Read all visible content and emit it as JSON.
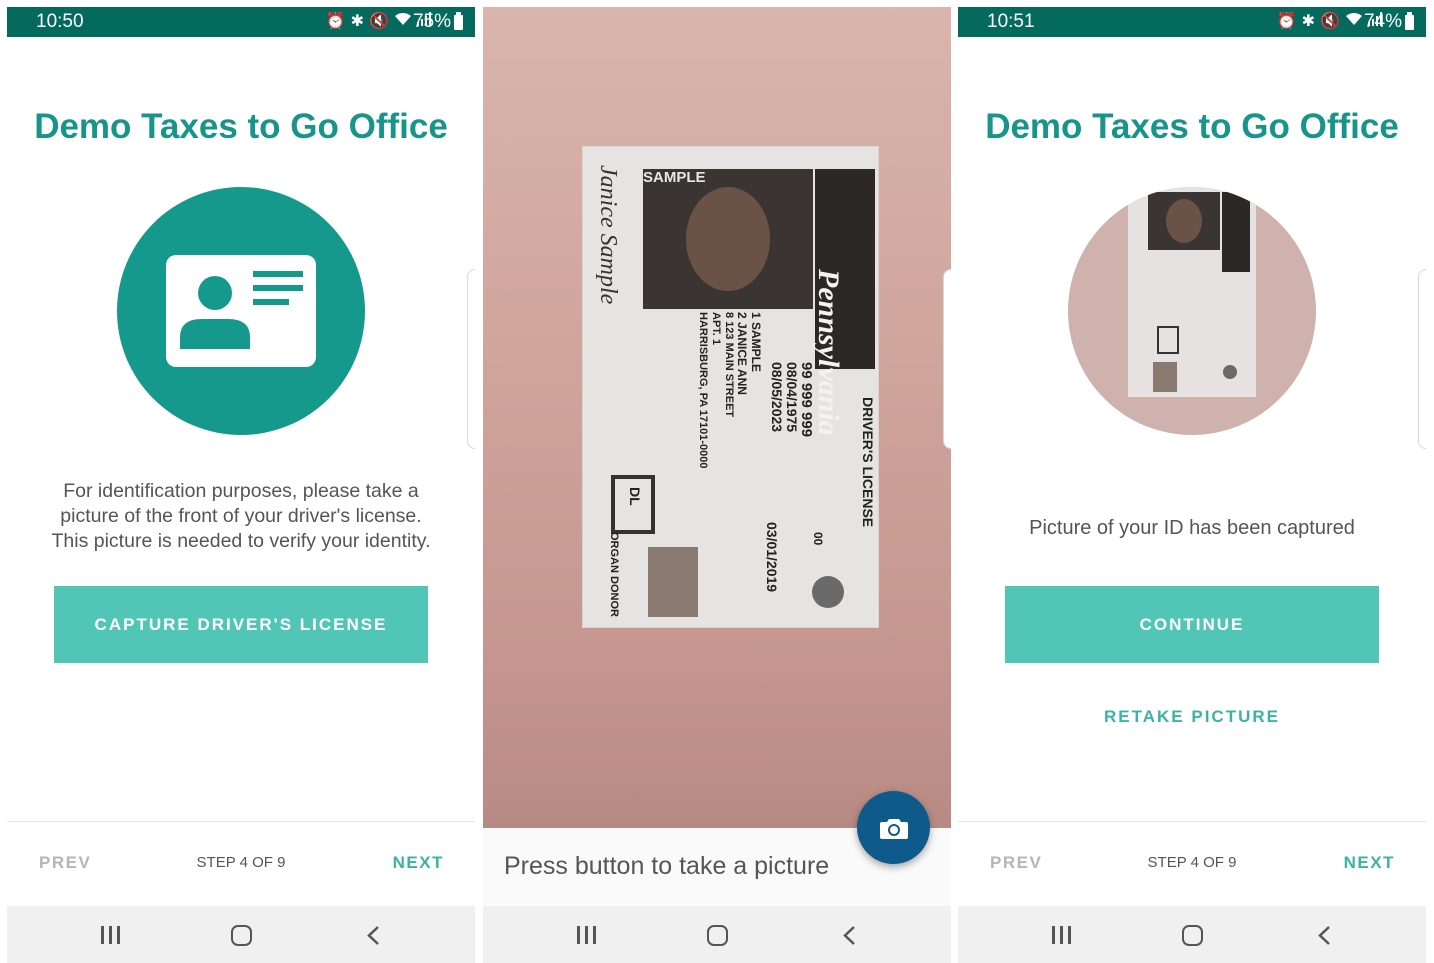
{
  "screens": [
    {
      "status": {
        "time": "10:50",
        "battery": "75%"
      },
      "title": "Demo Taxes to Go Office",
      "instructions": "For identification purposes, please take a picture of the front of your driver's license. This picture is needed to verify your identity.",
      "capture_button": "CAPTURE DRIVER'S LICENSE",
      "footer": {
        "prev": "PREV",
        "step": "STEP 4 OF 9",
        "next": "NEXT"
      }
    },
    {
      "camera_hint": "Press button to take a picture"
    },
    {
      "status": {
        "time": "10:51",
        "battery": "74%"
      },
      "title": "Demo Taxes to Go Office",
      "captured_message": "Picture of your ID has been captured",
      "continue_button": "CONTINUE",
      "retake_button": "RETAKE PICTURE",
      "footer": {
        "prev": "PREV",
        "step": "STEP 4 OF 9",
        "next": "NEXT"
      }
    }
  ],
  "license_text": {
    "sample": "SAMPLE",
    "state": "Pennsylvania",
    "card_type": "DRIVER'S LICENSE",
    "dl_number": "99 999 999",
    "dob": "08/04/1975",
    "expiry": "08/05/2023",
    "issued": "03/01/2019",
    "dups": "00",
    "name_line1": "1 SAMPLE",
    "name_line2": "2 JANICE ANN",
    "address": "8 123 MAIN STREET",
    "apt": "APT. 1",
    "city": "HARRISBURG, PA 17101-0000",
    "badge": "DL",
    "organ": "ORGAN DONOR",
    "signature": "Janice Sample"
  },
  "colors": {
    "status_bar": "#046a5e",
    "title": "#17958a",
    "accent_circle": "#14998c",
    "button": "#52c6b6",
    "link": "#3bb3a4",
    "fab": "#0d5a8b"
  },
  "icons": [
    "alarm-icon",
    "bluetooth-icon",
    "mute-icon",
    "wifi-icon",
    "signal-icon",
    "battery-icon",
    "id-card-icon",
    "camera-icon",
    "nav-recents-icon",
    "nav-home-icon",
    "nav-back-icon"
  ]
}
